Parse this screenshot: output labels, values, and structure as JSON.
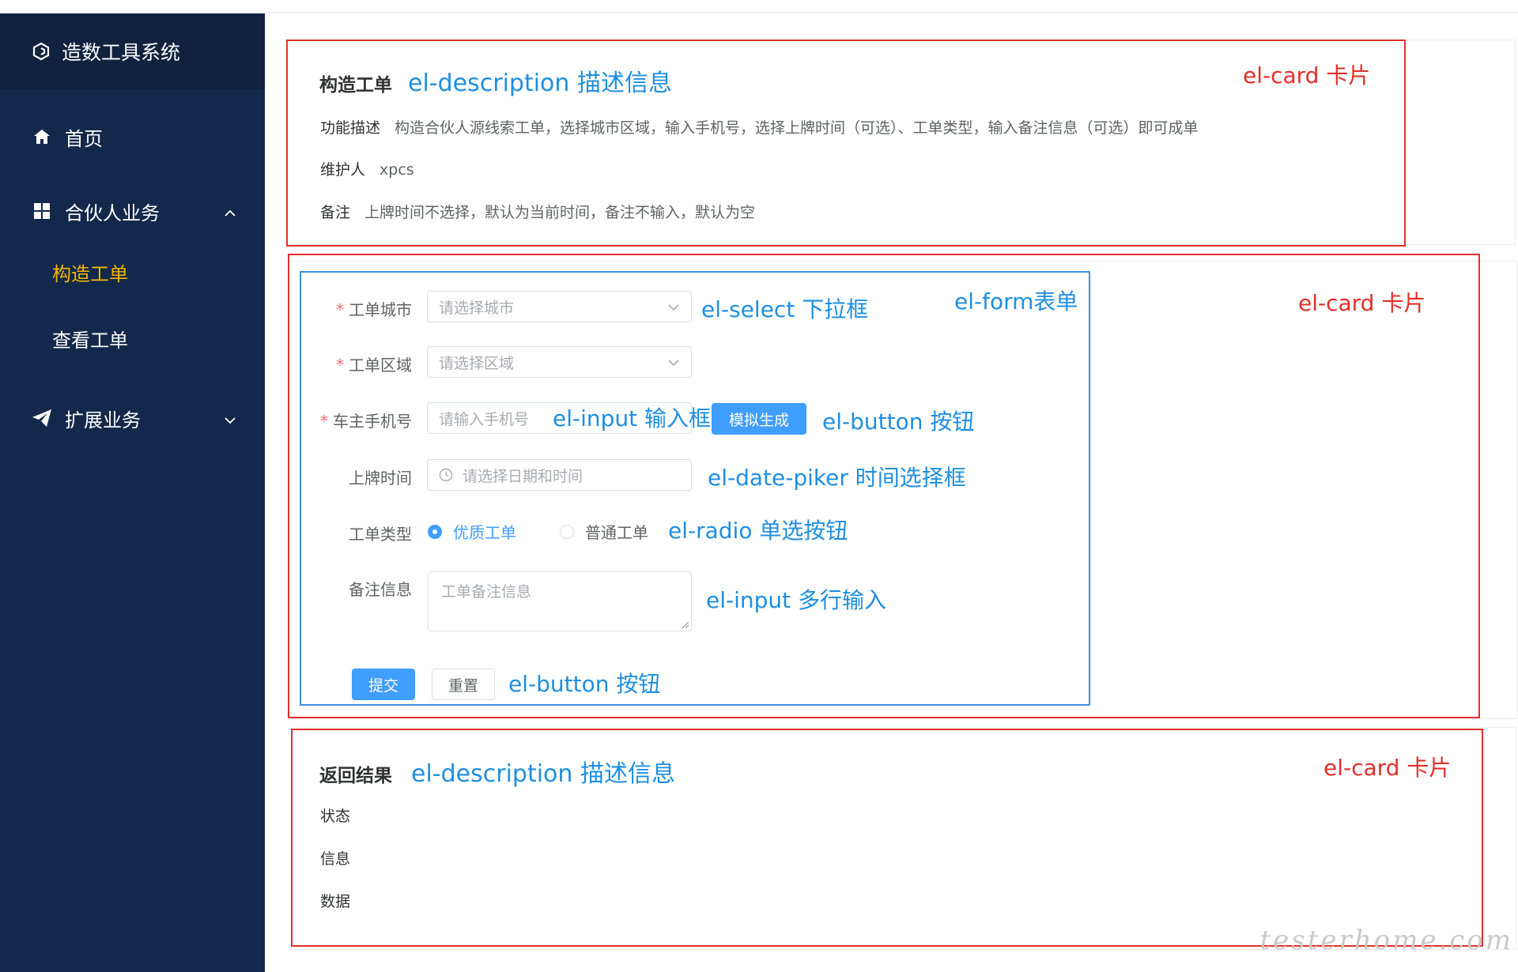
{
  "sidebar": {
    "app_title": "造数工具系统",
    "items": [
      {
        "label": "首页"
      },
      {
        "label": "合伙人业务"
      },
      {
        "label": "构造工单"
      },
      {
        "label": "查看工单"
      },
      {
        "label": "扩展业务"
      }
    ],
    "active_color": "#f5b800",
    "bg_color": "#13294b"
  },
  "card1": {
    "title": "构造工单",
    "annotation": "el-description 描述信息",
    "card_annotation": "el-card 卡片",
    "rows": [
      {
        "key": "功能描述",
        "value": "构造合伙人源线索工单，选择城市区域，输入手机号，选择上牌时间（可选）、工单类型，输入备注信息（可选）即可成单"
      },
      {
        "key": "维护人",
        "value": "xpcs"
      },
      {
        "key": "备注",
        "value": "上牌时间不选择，默认为当前时间，备注不输入，默认为空"
      }
    ]
  },
  "card2": {
    "card_annotation": "el-card 卡片",
    "form_annotation": "el-form表单",
    "fields": {
      "city": {
        "label": "工单城市",
        "placeholder": "请选择城市",
        "annotation": "el-select 下拉框"
      },
      "area": {
        "label": "工单区域",
        "placeholder": "请选择区域"
      },
      "phone": {
        "label": "车主手机号",
        "placeholder": "请输入手机号",
        "annotation": "el-input 输入框",
        "button": "模拟生成",
        "button_annotation": "el-button 按钮"
      },
      "date": {
        "label": "上牌时间",
        "placeholder": "请选择日期和时间",
        "annotation": "el-date-piker 时间选择框"
      },
      "type": {
        "label": "工单类型",
        "options": [
          "优质工单",
          "普通工单"
        ],
        "selected": "优质工单",
        "annotation": "el-radio 单选按钮"
      },
      "remark": {
        "label": "备注信息",
        "placeholder": "工单备注信息",
        "annotation": "el-input 多行输入"
      }
    },
    "submit_label": "提交",
    "reset_label": "重置",
    "buttons_annotation": "el-button 按钮"
  },
  "card3": {
    "title": "返回结果",
    "annotation": "el-description 描述信息",
    "card_annotation": "el-card 卡片",
    "rows": [
      {
        "key": "状态"
      },
      {
        "key": "信息"
      },
      {
        "key": "数据"
      }
    ]
  },
  "watermark": "testerhome.com",
  "colors": {
    "primary": "#409eff",
    "annotation_red": "#e2302b",
    "annotation_blue": "#1e8fe1"
  }
}
